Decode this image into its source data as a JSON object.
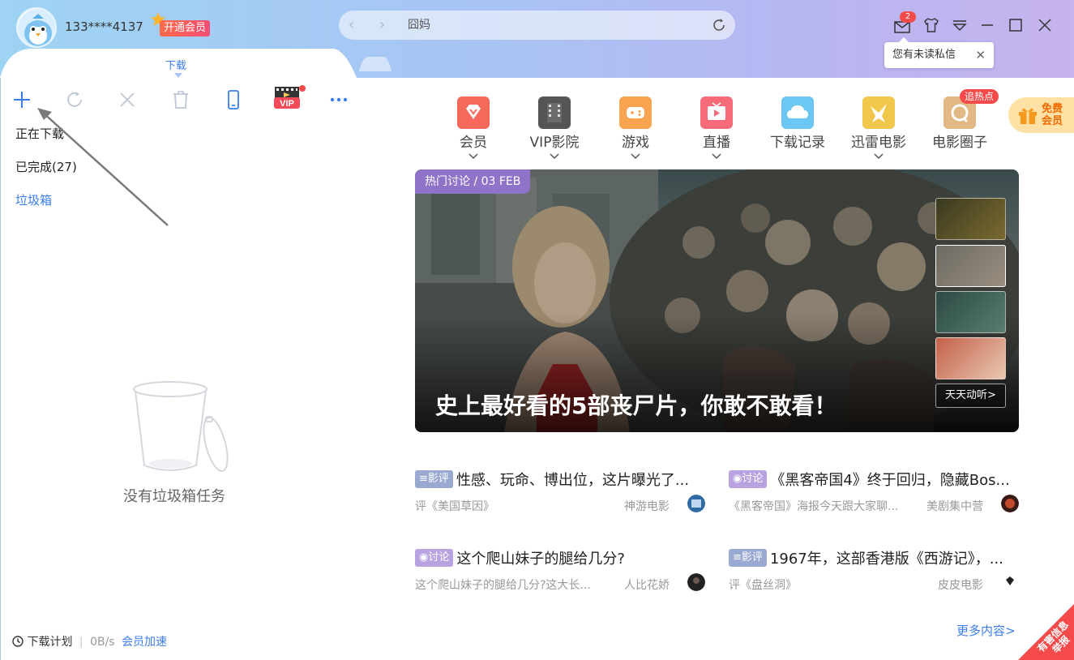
{
  "header": {
    "username": "133****4137",
    "vip_button": "开通会员",
    "url": "囧妈",
    "mail_count": "2",
    "tooltip": "您有未读私信",
    "tab_label": "下载"
  },
  "sidebar": {
    "items": [
      {
        "label": "正在下载"
      },
      {
        "label": "已完成(27)"
      },
      {
        "label": "垃圾箱"
      }
    ],
    "toolbar_icons": [
      "add-icon",
      "refresh-icon",
      "close-icon",
      "trash-icon",
      "phone-icon",
      "vip-video-icon",
      "more-icon"
    ],
    "vip_icon_text": "VIP",
    "empty_text": "没有垃圾箱任务",
    "footer": {
      "plan": "下载计划",
      "speed": "0B/s",
      "accelerate": "会员加速"
    }
  },
  "categories": [
    {
      "label": "会员",
      "color": "#f4695a"
    },
    {
      "label": "VIP影院",
      "color": "#555555"
    },
    {
      "label": "游戏",
      "color": "#f7a34f"
    },
    {
      "label": "直播",
      "color": "#f66a7a"
    },
    {
      "label": "下载记录",
      "color": "#6cc7f2"
    },
    {
      "label": "迅雷电影",
      "color": "#f1c84c"
    },
    {
      "label": "电影圈子",
      "color": "#e2b884"
    }
  ],
  "hot_badge": "追热点",
  "free_vip": {
    "line1": "免费",
    "line2": "会员"
  },
  "banner": {
    "tag": "热门讨论 / 03 FEB",
    "title": "史上最好看的5部丧尸片，你敢不敢看！",
    "more": "天天动听>"
  },
  "articles": [
    {
      "tag": "影评",
      "tag_color": "#9aa9d2",
      "title": "性感、玩命、博出位，这片曝光了...",
      "sub": "评《美国草因》",
      "source": "神游电影"
    },
    {
      "tag": "讨论",
      "tag_color": "#b8a3e0",
      "title": "《黑客帝国4》终于回归，隐藏Bos...",
      "sub": "《黑客帝国》海报今天跟大家聊...",
      "source": "美剧集中营"
    },
    {
      "tag": "讨论",
      "tag_color": "#b8a3e0",
      "title": "这个爬山妹子的腿给几分?",
      "sub": "这个爬山妹子的腿给几分?这大长...",
      "source": "人比花娇"
    },
    {
      "tag": "影评",
      "tag_color": "#9aa9d2",
      "title": "1967年，这部香港版《西游记》，...",
      "sub": "评《盘丝洞》",
      "source": "皮皮电影"
    }
  ],
  "more_content": "更多内容>",
  "report": {
    "line1": "有害信息",
    "line2": "举报"
  }
}
